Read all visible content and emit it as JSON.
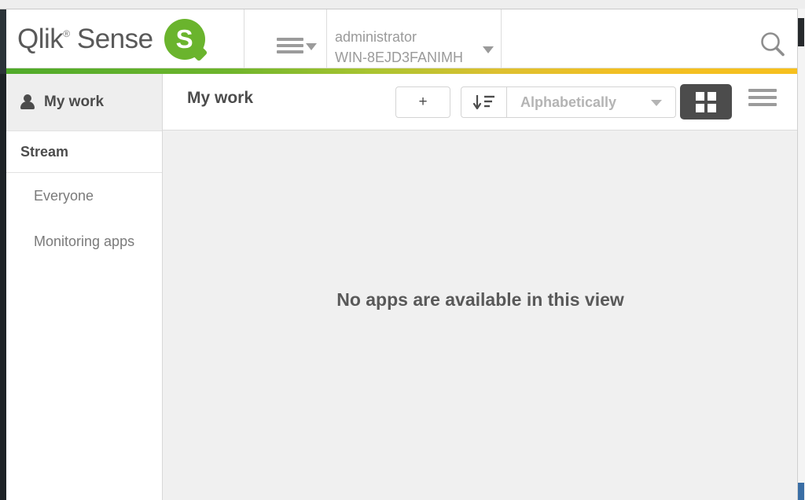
{
  "brand": {
    "name": "Qlik",
    "registered": "®",
    "product": "Sense",
    "mark_letter": "S",
    "mark_color": "#6ab42d"
  },
  "header": {
    "menu_icon": "hamburger-icon",
    "menu_caret_icon": "caret-down-icon",
    "user": {
      "account": "administrator",
      "host": "WIN-8EJD3FANIMH",
      "caret_icon": "caret-down-icon"
    },
    "search_icon": "search-icon",
    "accent_gradient_from": "#4faa2a",
    "accent_gradient_to": "#f6c01e"
  },
  "sidebar": {
    "my_work": {
      "label": "My work",
      "icon": "person-icon"
    },
    "stream_header": "Stream",
    "items": [
      {
        "label": "Everyone"
      },
      {
        "label": "Monitoring apps"
      }
    ]
  },
  "toolbar": {
    "title": "My work",
    "add_label": "+",
    "sort_direction_icon": "sort-descending-icon",
    "sort_value": "Alphabetically",
    "sort_caret_icon": "caret-down-icon",
    "view_grid_icon": "grid-view-icon",
    "view_list_icon": "list-view-icon",
    "active_view": "grid"
  },
  "main": {
    "empty_message": "No apps are available in this view"
  }
}
